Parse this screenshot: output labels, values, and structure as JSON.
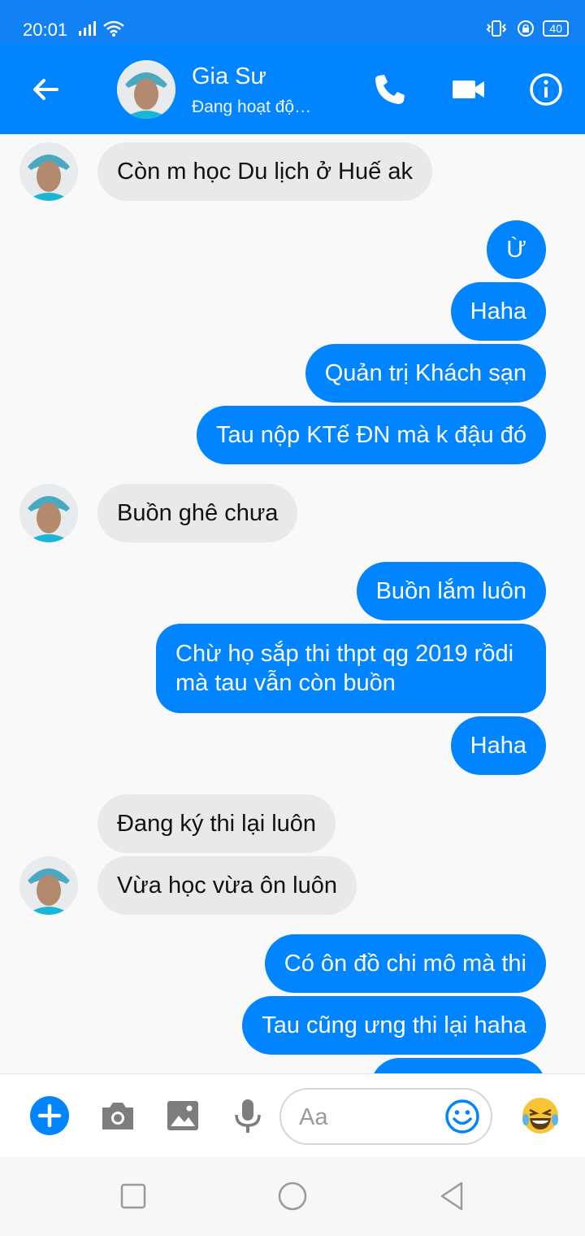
{
  "status_bar": {
    "time": "20:01",
    "battery": "40",
    "icons": [
      "signal-icon",
      "wifi-icon",
      "vibrate-icon",
      "lock-rotation-icon",
      "battery-icon"
    ]
  },
  "header": {
    "contact_name": "Gia Sư",
    "contact_status": "Đang hoạt độ…",
    "icons": [
      "back-arrow-icon",
      "phone-icon",
      "video-camera-icon",
      "info-icon"
    ]
  },
  "messages": [
    {
      "dir": "in",
      "text": "Còn m học Du lịch ở Huế ak"
    },
    {
      "dir": "out",
      "text": "Ừ"
    },
    {
      "dir": "out",
      "text": "Haha"
    },
    {
      "dir": "out",
      "text": "Quản trị Khách sạn"
    },
    {
      "dir": "out",
      "text": "Tau nộp KTế ĐN mà k đậu đó"
    },
    {
      "dir": "in",
      "text": "Buồn ghê chưa"
    },
    {
      "dir": "out",
      "text": "Buồn lắm luôn"
    },
    {
      "dir": "out",
      "text": "Chừ họ sắp thi thpt qg 2019 rồdi mà tau vẫn còn buồn"
    },
    {
      "dir": "out",
      "text": "Haha"
    },
    {
      "dir": "in",
      "text": "Đang ký thi lại luôn"
    },
    {
      "dir": "in",
      "text": "Vừa học vừa ôn luôn"
    },
    {
      "dir": "out",
      "text": "Có ôn đồ chi mô mà thi"
    },
    {
      "dir": "out",
      "text": "Tau cũng ưng thi lại haha"
    }
  ],
  "composer": {
    "placeholder": "Aa",
    "icons": [
      "plus-icon",
      "camera-icon",
      "image-icon",
      "microphone-icon",
      "smile-icon",
      "laughing-emoji-icon"
    ]
  },
  "colors": {
    "header": "#0084ff",
    "outgoing_bubble": "#0084ff",
    "incoming_bubble": "#e9e9eb"
  }
}
